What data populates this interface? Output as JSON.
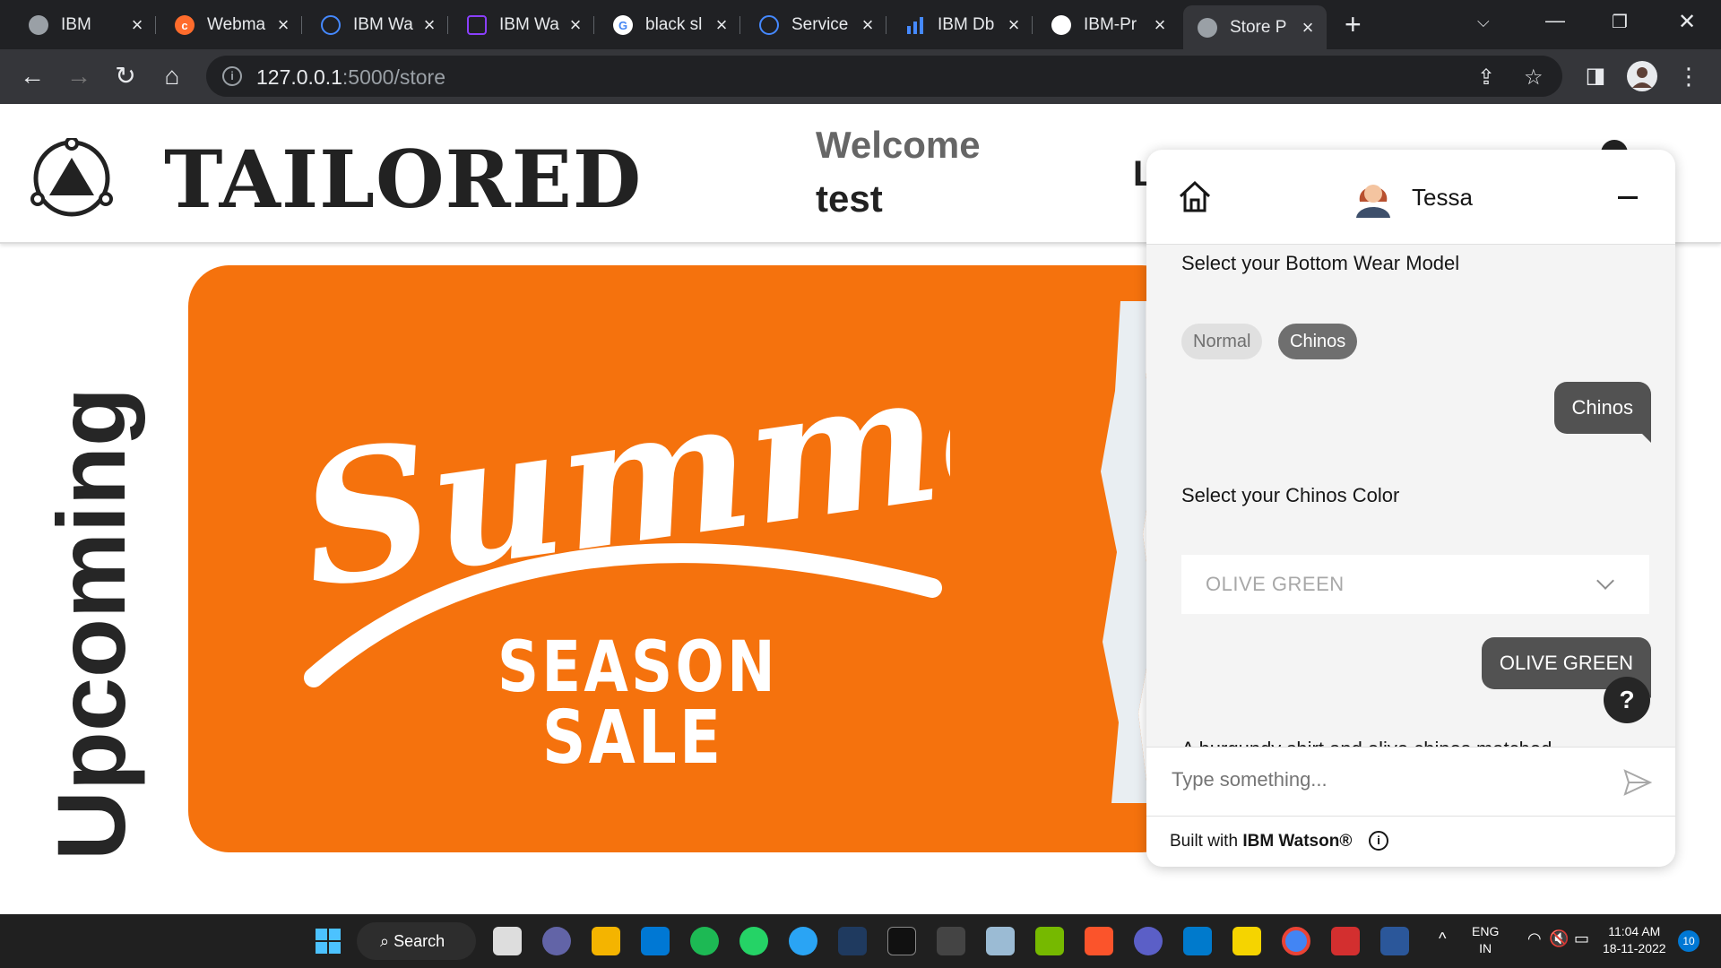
{
  "browser": {
    "tabs": [
      {
        "title": "IBM",
        "favicon": "globe-icon",
        "color": "#9aa0a6"
      },
      {
        "title": "Webma",
        "favicon": "cpanel-icon",
        "color": "#ff6c2c"
      },
      {
        "title": "IBM Wa",
        "favicon": "ibm-cloud-icon",
        "color": "#4589ff"
      },
      {
        "title": "IBM Wa",
        "favicon": "watson-assistant-icon",
        "color": "#8a3ffc"
      },
      {
        "title": "black sl",
        "favicon": "google-icon",
        "color": "#ffffff"
      },
      {
        "title": "Service",
        "favicon": "ibm-cloud-icon",
        "color": "#4589ff"
      },
      {
        "title": "IBM Db",
        "favicon": "db2-chart-icon",
        "color": "#4589ff"
      },
      {
        "title": "IBM-Pr",
        "favicon": "github-icon",
        "color": "#ffffff"
      },
      {
        "title": "Store P",
        "favicon": "globe-icon",
        "color": "#9aa0a6",
        "active": true
      }
    ],
    "url_host": "127.0.0.1",
    "url_path": ":5000/store"
  },
  "site": {
    "brand": "TAILORED",
    "welcome": "Welcome",
    "username": "test",
    "partial_nav": "L",
    "upcoming": "Upcoming",
    "banner": {
      "headline": "Summer",
      "line1": "SEASON",
      "line2": "SALE",
      "color": "#f5720d"
    }
  },
  "chat": {
    "bot_name": "Tessa",
    "q1": "Select your Bottom Wear Model",
    "options": [
      "Normal",
      "Chinos"
    ],
    "selected_option": "Chinos",
    "reply1": "Chinos",
    "q2": "Select your Chinos Color",
    "dropdown_value": "OLIVE GREEN",
    "reply2": "OLIVE GREEN",
    "cut_text": "A burgundy shirt and olive chinos matched",
    "input_placeholder": "Type something...",
    "footer_prefix": "Built with ",
    "footer_brand": "IBM Watson®"
  },
  "taskbar": {
    "search_label": "Search",
    "lang_line1": "ENG",
    "lang_line2": "IN",
    "time": "11:04 AM",
    "date": "18-11-2022",
    "notifications": "10"
  }
}
